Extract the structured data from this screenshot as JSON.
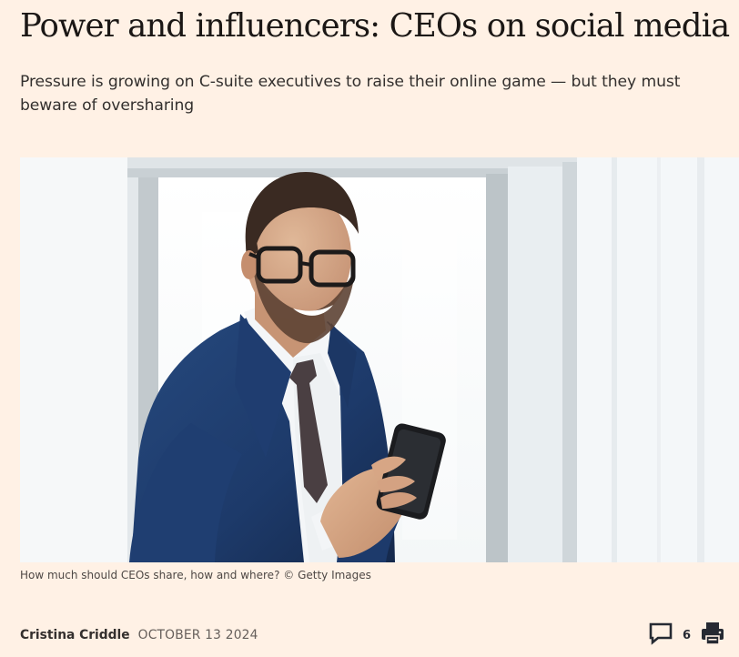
{
  "article": {
    "headline": "Power and influencers: CEOs on social media",
    "standfirst": "Pressure is growing on C-suite executives to raise their online game — but they must beware of oversharing",
    "image": {
      "caption": "How much should CEOs share, how and where? © Getty Images"
    },
    "byline": {
      "author": "Cristina Criddle",
      "date": "OCTOBER 13 2024"
    },
    "tools": {
      "comment_icon": "speech-bubble-icon",
      "comment_count": "6",
      "print_icon": "printer-icon"
    }
  },
  "colors": {
    "page_background": "#fff1e5",
    "headline_text": "#1b1715",
    "body_text": "#33302e",
    "muted_text": "#66605c"
  }
}
